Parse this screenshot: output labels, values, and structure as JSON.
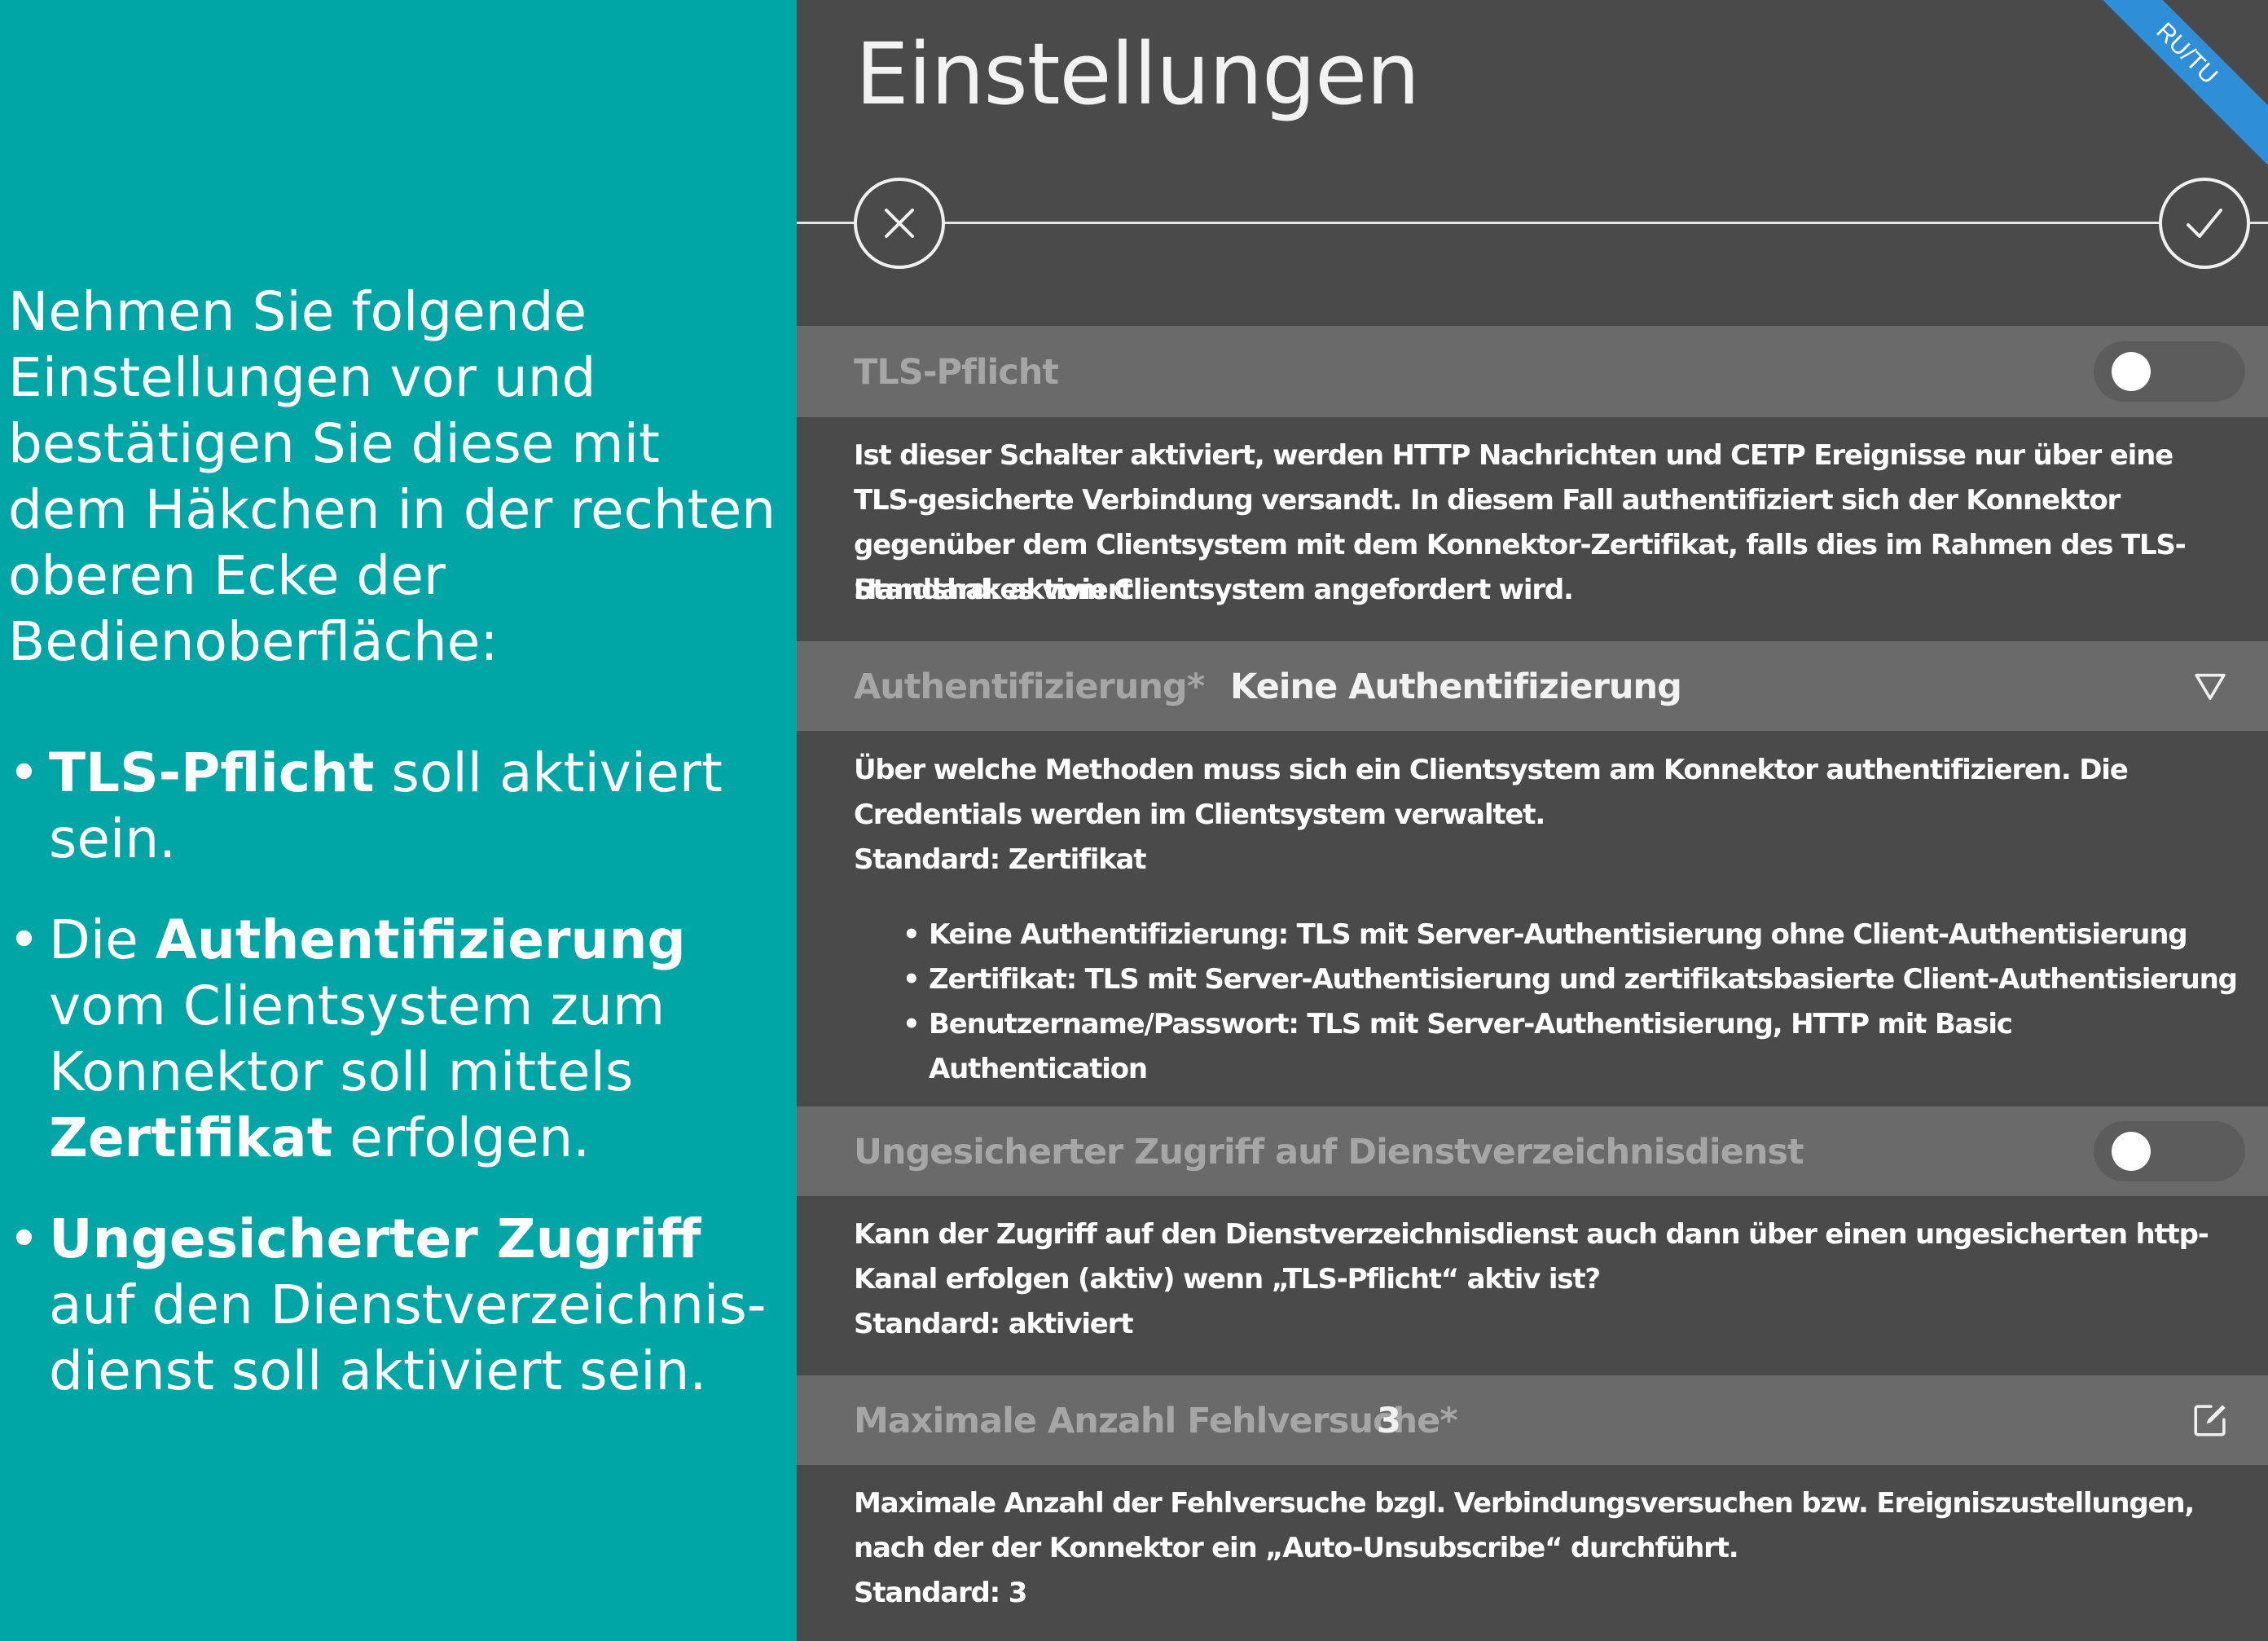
{
  "left_panel": {
    "intro": "Nehmen Sie folgende Einstellungen vor und bestätigen Sie diese mit dem Häkchen in der rechten oberen Ecke der Bedienoberfläche:",
    "bullets": [
      {
        "pre": "",
        "bold": "TLS-Pflicht",
        "post": " soll aktiviert sein."
      },
      {
        "pre": "Die ",
        "bold": "Authentifizierung",
        "mid": " vom Clientsystem zum Konnektor soll mittels ",
        "bold2": "Zertifikat",
        "post": " erfolgen."
      },
      {
        "pre": "",
        "bold": "Ungesicherter Zugriff",
        "post": " auf den Dienstverzeichnis-dienst soll aktiviert sein."
      }
    ],
    "bullet_glyph": "•",
    "background_color": "#00a6a6"
  },
  "settings": {
    "title": "Einstellungen",
    "ribbon_label": "RU/TU",
    "cancel_icon": "close-icon",
    "confirm_icon": "check-icon",
    "tls": {
      "label": "TLS-Pflicht",
      "toggle_state": "off",
      "description": "Ist dieser Schalter aktiviert, werden HTTP Nachrichten und CETP Ereignisse nur über eine TLS-gesicherte Verbindung versandt. In diesem Fall authentifiziert sich der Konnektor gegenüber dem Clientsystem mit dem Konnektor-Zertifikat, falls dies im Rahmen des TLS-Handshakes vom Clientsystem angefordert wird.",
      "default": "Standard: aktiviert"
    },
    "auth": {
      "label": "Authentifizierung*",
      "value": "Keine Authentifizierung",
      "dropdown_icon": "triangle-down-icon",
      "description": "Über welche Methoden muss sich ein Clientsystem am Konnektor authentifizieren. Die Credentials werden im Clientsystem verwaltet.",
      "default": "Standard: Zertifikat",
      "options": [
        "Keine Authentifizierung: TLS mit Server-Authentisierung ohne Client-Authentisierung",
        "Zertifikat: TLS mit Server-Authentisierung und zertifikatsbasierte Client-Authentisierung",
        "Benutzername/Passwort: TLS mit Server-Authentisierung, HTTP mit Basic Authentication"
      ]
    },
    "unsecured": {
      "label": "Ungesicherter Zugriff auf Dienstverzeichnisdienst",
      "toggle_state": "off",
      "description": "Kann der Zugriff auf den Dienstverzeichnisdienst auch dann über einen ungesicherten http-Kanal erfolgen (aktiv) wenn „TLS-Pflicht“ aktiv ist?",
      "default": "Standard: aktiviert"
    },
    "max_attempts": {
      "label": "Maximale Anzahl Fehlversuche*",
      "value": "3",
      "edit_icon": "edit-icon",
      "description": "Maximale Anzahl der Fehlversuche bzgl. Verbindungsversuchen bzw. Ereigniszustellungen, nach der der Konnektor ein „Auto-Unsubscribe“ durchführt.",
      "default": "Standard: 3"
    }
  }
}
